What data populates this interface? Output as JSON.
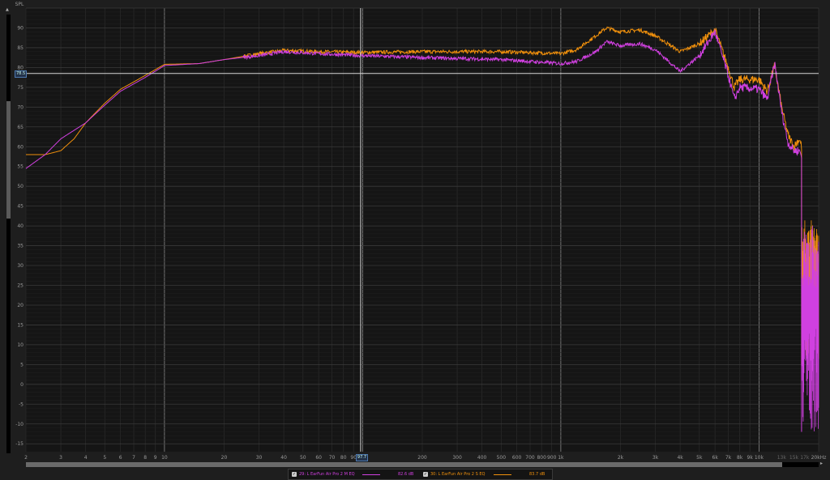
{
  "chart_data": {
    "type": "line",
    "title": "",
    "ylabel": "SPL",
    "xlabel": "",
    "xscale": "log",
    "xlim": [
      2,
      20000
    ],
    "ylim": [
      -17,
      95
    ],
    "grid": true,
    "y_ticks": [
      "90",
      "85",
      "80",
      "75",
      "70",
      "65",
      "60",
      "55",
      "50",
      "45",
      "40",
      "35",
      "30",
      "25",
      "20",
      "15",
      "10",
      "5",
      "0",
      "-5",
      "-10",
      "-15"
    ],
    "x_ticks": [
      {
        "f": 2,
        "label": "2"
      },
      {
        "f": 3,
        "label": "3"
      },
      {
        "f": 4,
        "label": "4"
      },
      {
        "f": 5,
        "label": "5"
      },
      {
        "f": 6,
        "label": "6"
      },
      {
        "f": 7,
        "label": "7"
      },
      {
        "f": 8,
        "label": "8"
      },
      {
        "f": 9,
        "label": "9"
      },
      {
        "f": 10,
        "label": "10"
      },
      {
        "f": 20,
        "label": "20"
      },
      {
        "f": 30,
        "label": "30"
      },
      {
        "f": 40,
        "label": "40"
      },
      {
        "f": 50,
        "label": "50"
      },
      {
        "f": 60,
        "label": "60"
      },
      {
        "f": 70,
        "label": "70"
      },
      {
        "f": 80,
        "label": "80"
      },
      {
        "f": 90,
        "label": "90"
      },
      {
        "f": 200,
        "label": "200"
      },
      {
        "f": 300,
        "label": "300"
      },
      {
        "f": 400,
        "label": "400"
      },
      {
        "f": 500,
        "label": "500"
      },
      {
        "f": 600,
        "label": "600"
      },
      {
        "f": 700,
        "label": "700"
      },
      {
        "f": 800,
        "label": "800"
      },
      {
        "f": 900,
        "label": "900"
      },
      {
        "f": 1000,
        "label": "1k"
      },
      {
        "f": 2000,
        "label": "2k"
      },
      {
        "f": 3000,
        "label": "3k"
      },
      {
        "f": 4000,
        "label": "4k"
      },
      {
        "f": 5000,
        "label": "5k"
      },
      {
        "f": 6000,
        "label": "6k"
      },
      {
        "f": 7000,
        "label": "7k"
      },
      {
        "f": 8000,
        "label": "8k"
      },
      {
        "f": 9000,
        "label": "9k"
      },
      {
        "f": 10000,
        "label": "10k"
      },
      {
        "f": 13000,
        "label": "13k",
        "dim": true
      },
      {
        "f": 15000,
        "label": "15k",
        "dim": true
      },
      {
        "f": 17000,
        "label": "17k",
        "dim": true
      },
      {
        "f": 20000,
        "label": "20kHz"
      }
    ],
    "cursor": {
      "freq_label": "97.7",
      "spl_label": "78.5",
      "freq": 97.7,
      "spl": 78.5
    },
    "series": [
      {
        "name": "29: L EarFun Air Pro 2 M EQ",
        "color": "#d040e0",
        "value_label": "82.6 dB",
        "freq": [
          2,
          2.5,
          3,
          4,
          5,
          6,
          8,
          10,
          15,
          20,
          30,
          40,
          60,
          100,
          200,
          500,
          1000,
          1200,
          1500,
          1700,
          2000,
          2500,
          3000,
          4000,
          5000,
          6000,
          7000,
          7500,
          8000,
          10000,
          11000,
          12000,
          13000,
          14000,
          15000,
          16000,
          16400
        ],
        "spl": [
          54.5,
          58,
          62,
          66,
          70.5,
          74,
          77.5,
          80.5,
          81,
          82,
          83,
          84,
          83.5,
          83,
          82.5,
          82,
          81,
          81.5,
          84,
          86.5,
          85.5,
          86,
          84.5,
          79,
          83,
          89,
          78,
          72,
          75,
          74.5,
          72,
          81,
          69,
          61,
          59,
          59,
          58
        ],
        "noise_range": [
          -12,
          40
        ]
      },
      {
        "name": "30: L EarFun Air Pro 2 S EQ",
        "color": "#f0900c",
        "value_label": "83.7 dB",
        "freq": [
          2,
          2.5,
          3,
          3.5,
          4,
          5,
          6,
          8,
          10,
          15,
          20,
          30,
          40,
          60,
          100,
          200,
          500,
          1000,
          1200,
          1500,
          1700,
          2000,
          2500,
          3000,
          4000,
          5000,
          6000,
          7000,
          7500,
          8000,
          10000,
          11000,
          12000,
          13000,
          14000,
          15000,
          16000,
          16400
        ],
        "spl": [
          58,
          58,
          59,
          62,
          66,
          71,
          74.5,
          78,
          80.8,
          81,
          82,
          83.5,
          84.3,
          84,
          83.8,
          84,
          84,
          83.5,
          84.5,
          88,
          90,
          89,
          89.5,
          88,
          84,
          86,
          89.5,
          80,
          75,
          77,
          77,
          74,
          80.5,
          70,
          63,
          60,
          62,
          60
        ],
        "noise_range": [
          5,
          42
        ]
      }
    ]
  }
}
